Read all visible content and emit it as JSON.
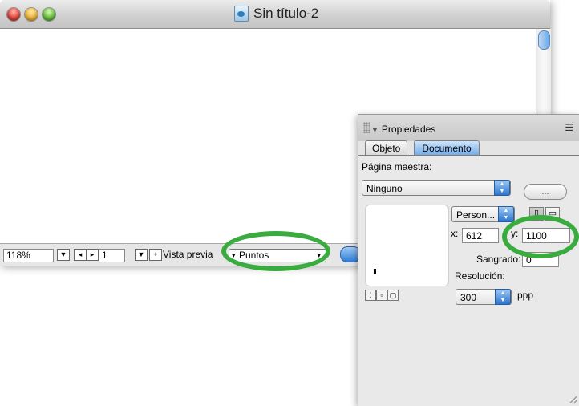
{
  "window": {
    "title": "Sin título-2",
    "title_icon": "document-icon"
  },
  "statusbar": {
    "zoom": "118%",
    "page": "1",
    "preview_label": "Vista previa",
    "units": "Puntos"
  },
  "panel": {
    "title": "Propiedades",
    "tabs": {
      "object": "Objeto",
      "document": "Documento"
    },
    "master_page_label": "Página maestra:",
    "master_page_value": "Ninguno",
    "ellipsis": "...",
    "size_preset": "Person...",
    "x_label": "x:",
    "x_value": "612",
    "y_label": "y:",
    "y_value": "1100",
    "bleed_label": "Sangrado:",
    "bleed_value": "0",
    "resolution_label": "Resolución:",
    "resolution_value": "300",
    "resolution_unit": "ppp"
  },
  "colors": {
    "highlight": "#3aab3f",
    "accent": "#2f7ed8"
  }
}
